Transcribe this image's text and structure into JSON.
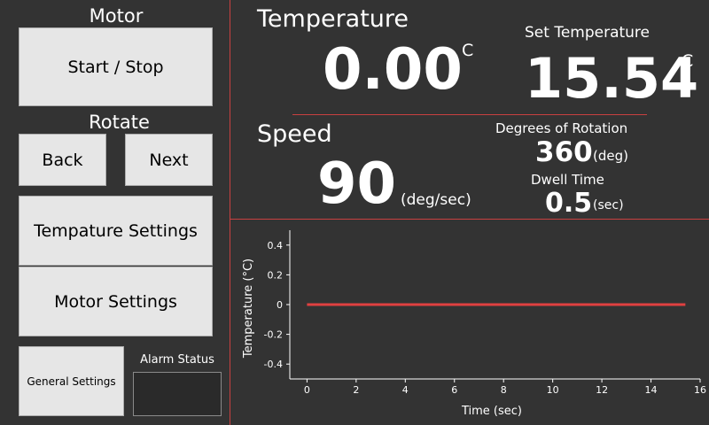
{
  "left_panel": {
    "motor_label": "Motor",
    "start_stop_label": "Start / Stop",
    "rotate_label": "Rotate",
    "back_label": "Back",
    "next_label": "Next",
    "temp_settings_label": "Tempature Settings",
    "motor_settings_label": "Motor Settings",
    "general_settings_label": "General Settings",
    "alarm_status_label": "Alarm Status"
  },
  "temperature": {
    "title": "Temperature",
    "value": "0.00",
    "unit": "C"
  },
  "set_temperature": {
    "title": "Set Temperature",
    "value": "15.54",
    "unit": "C"
  },
  "speed": {
    "title": "Speed",
    "value": "90",
    "unit": "(deg/sec)"
  },
  "rotation": {
    "title": "Degrees of Rotation",
    "value": "360",
    "unit": "(deg)"
  },
  "dwell": {
    "title": "Dwell Time",
    "value": "0.5",
    "unit": "(sec)"
  },
  "colors": {
    "background": "#333333",
    "accent_red": "#c94040",
    "plot_line": "#e04040",
    "button_bg": "#e6e6e6"
  },
  "chart_data": {
    "type": "line",
    "xlabel": "Time (sec)",
    "ylabel": "Temperature (°C)",
    "xlim": [
      -0.7,
      16
    ],
    "ylim": [
      -0.5,
      0.5
    ],
    "xticks": [
      0,
      2,
      4,
      6,
      8,
      10,
      12,
      14,
      16
    ],
    "xtick_labels": [
      "0",
      "2",
      "4",
      "6",
      "8",
      "10",
      "12",
      "14",
      "16"
    ],
    "yticks": [
      0.4,
      0.2,
      0,
      -0.2,
      -0.4
    ],
    "ytick_labels": [
      "0.4",
      "0.2",
      "0",
      "-0.2",
      "-0.4"
    ],
    "series": [
      {
        "x": [
          0,
          15.4
        ],
        "y": [
          0,
          0
        ]
      }
    ]
  }
}
